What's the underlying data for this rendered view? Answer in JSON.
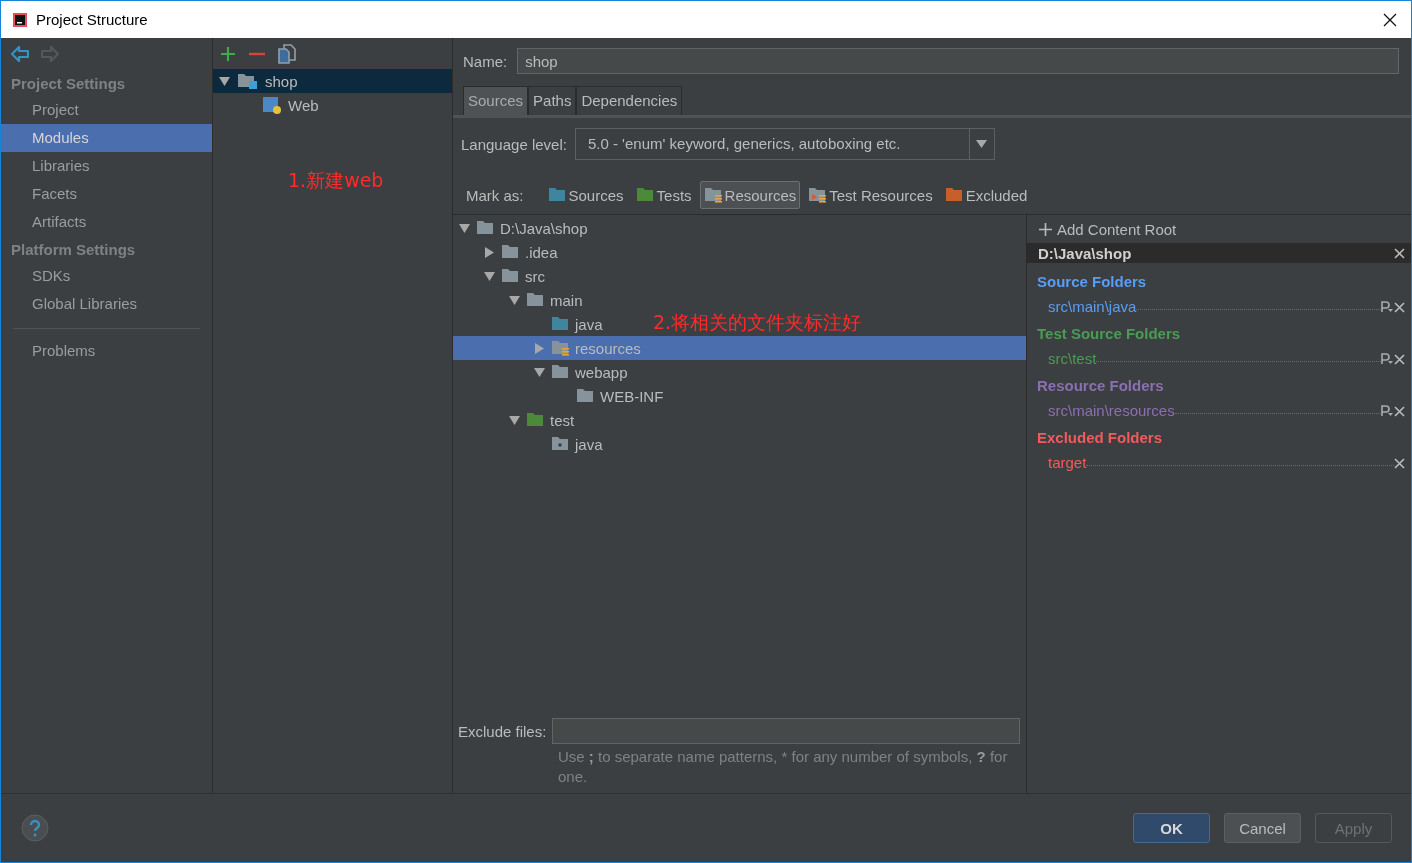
{
  "window": {
    "title": "Project Structure"
  },
  "sidebar": {
    "sections": [
      {
        "title": "Project Settings",
        "items": [
          {
            "label": "Project",
            "selected": false
          },
          {
            "label": "Modules",
            "selected": true
          },
          {
            "label": "Libraries",
            "selected": false
          },
          {
            "label": "Facets",
            "selected": false
          },
          {
            "label": "Artifacts",
            "selected": false
          }
        ]
      },
      {
        "title": "Platform Settings",
        "items": [
          {
            "label": "SDKs",
            "selected": false
          },
          {
            "label": "Global Libraries",
            "selected": false
          }
        ]
      },
      {
        "items": [
          {
            "label": "Problems",
            "selected": false
          }
        ]
      }
    ]
  },
  "modules": {
    "tree": [
      {
        "label": "shop",
        "kind": "module",
        "expanded": true,
        "selected": true,
        "children": [
          {
            "label": "Web",
            "kind": "facet",
            "selected": false
          }
        ]
      }
    ]
  },
  "name_field": {
    "label": "Name:",
    "value": "shop"
  },
  "tabs": [
    {
      "label": "Sources",
      "selected": true
    },
    {
      "label": "Paths",
      "selected": false
    },
    {
      "label": "Dependencies",
      "selected": false
    }
  ],
  "language_level": {
    "label": "Language level:",
    "value": "5.0 - 'enum' keyword, generics, autoboxing etc."
  },
  "mark_as": {
    "label": "Mark as:",
    "buttons": [
      {
        "label": "Sources",
        "kind": "source",
        "selected": false
      },
      {
        "label": "Tests",
        "kind": "test",
        "selected": false
      },
      {
        "label": "Resources",
        "kind": "resource",
        "selected": true
      },
      {
        "label": "Test Resources",
        "kind": "test_resource",
        "selected": false
      },
      {
        "label": "Excluded",
        "kind": "excluded",
        "selected": false
      }
    ]
  },
  "folder_tree": [
    {
      "label": "D:\\Java\\shop",
      "kind": "plain",
      "expanded": true,
      "selected": false,
      "children": [
        {
          "label": ".idea",
          "kind": "plain",
          "expanded": false,
          "selected": false
        },
        {
          "label": "src",
          "kind": "plain",
          "expanded": true,
          "selected": false,
          "children": [
            {
              "label": "main",
              "kind": "plain",
              "expanded": true,
              "selected": false,
              "children": [
                {
                  "label": "java",
                  "kind": "source",
                  "selected": false
                },
                {
                  "label": "resources",
                  "kind": "resource",
                  "expanded": false,
                  "selected": true
                },
                {
                  "label": "webapp",
                  "kind": "plain",
                  "expanded": true,
                  "selected": false,
                  "children": [
                    {
                      "label": "WEB-INF",
                      "kind": "plain",
                      "selected": false
                    }
                  ]
                }
              ]
            },
            {
              "label": "test",
              "kind": "test",
              "expanded": true,
              "selected": false,
              "children": [
                {
                  "label": "java",
                  "kind": "package",
                  "selected": false
                }
              ]
            }
          ]
        }
      ]
    }
  ],
  "content_root": {
    "add_label": "Add Content Root",
    "path": "D:\\Java\\shop",
    "groups": [
      {
        "title": "Source Folders",
        "color": "#589df6",
        "editable": true,
        "folders": [
          "src\\main\\java"
        ]
      },
      {
        "title": "Test Source Folders",
        "color": "#499c54",
        "editable": true,
        "folders": [
          "src\\test"
        ]
      },
      {
        "title": "Resource Folders",
        "color": "#8c6fb0",
        "editable": true,
        "folders": [
          "src\\main\\resources"
        ]
      },
      {
        "title": "Excluded Folders",
        "color": "#f25b5b",
        "editable": false,
        "folders": [
          "target"
        ]
      }
    ]
  },
  "exclude_files": {
    "label": "Exclude files:",
    "hint": "Use **;** to separate name patterns, * for any number of symbols, **?** for one."
  },
  "annotations": [
    {
      "text": "1.新建web",
      "kind": "modules"
    },
    {
      "text": "2.将相关的文件夹标注好",
      "kind": "tree"
    }
  ],
  "buttons": [
    {
      "label": "OK",
      "kind": "default",
      "disabled": false
    },
    {
      "label": "Cancel",
      "kind": "normal",
      "disabled": false
    },
    {
      "label": "Apply",
      "kind": "normal",
      "disabled": true
    }
  ]
}
